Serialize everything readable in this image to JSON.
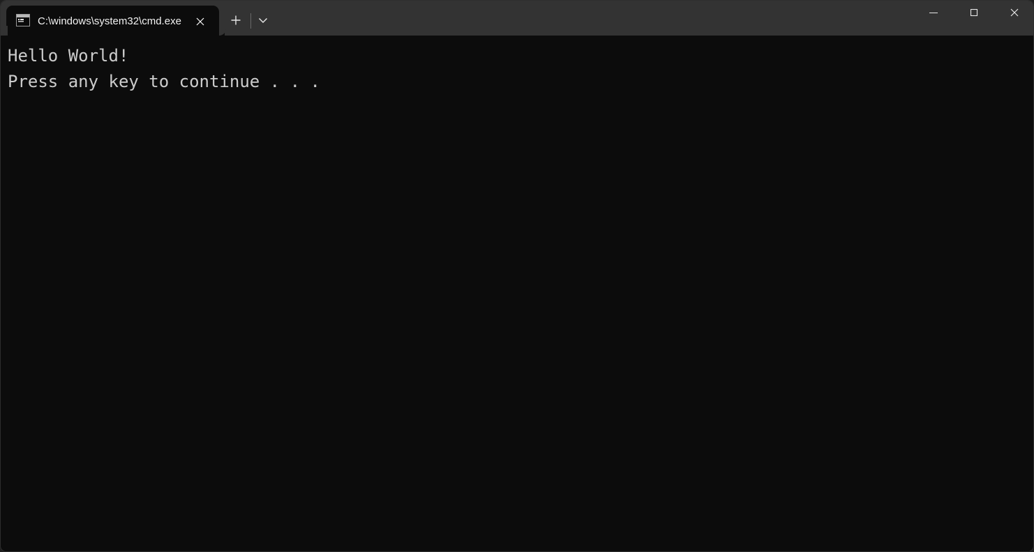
{
  "window": {
    "background_color": "#0c0c0c",
    "titlebar_color": "#333333",
    "border_color": "#2e2e2e"
  },
  "titlebar": {
    "tabs": [
      {
        "title": "C:\\windows\\system32\\cmd.exe",
        "icon": "console-icon",
        "active": true,
        "close_label": "✕"
      }
    ],
    "new_tab_label": "+",
    "dropdown_label": "⌄",
    "controls": {
      "minimize_label": "─",
      "maximize_label": "□",
      "close_label": "✕"
    }
  },
  "terminal": {
    "foreground_color": "#cccccc",
    "lines": [
      "Hello World!",
      "Press any key to continue . . ."
    ]
  }
}
